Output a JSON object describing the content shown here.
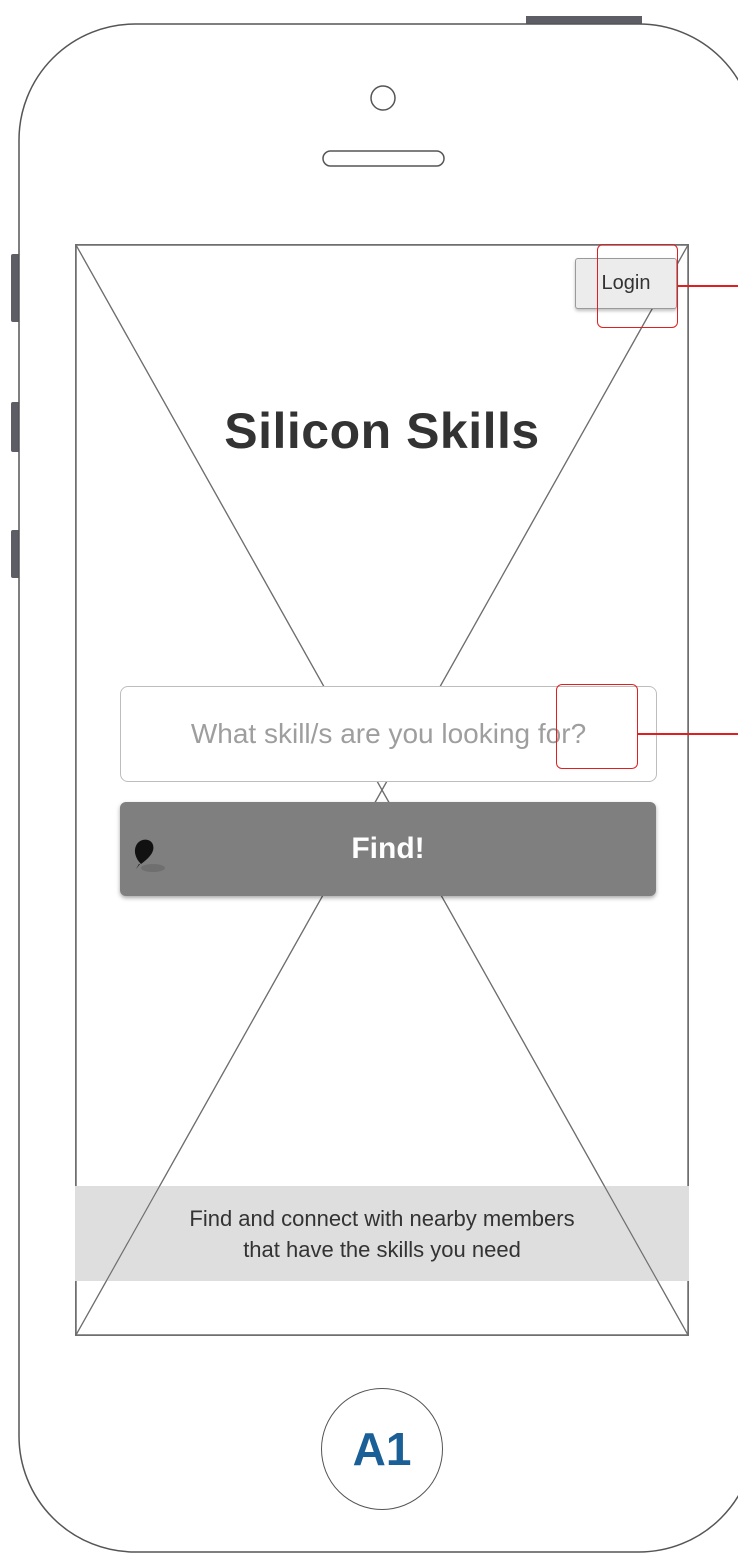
{
  "screen": {
    "login_label": "Login",
    "app_title": "Silicon Skills",
    "search_placeholder": "What skill/s are you looking for?",
    "find_label": "Find!",
    "tagline_line1": "Find and connect with nearby members",
    "tagline_line2": "that have the skills you need"
  },
  "device": {
    "home_label": "A1"
  },
  "colors": {
    "annotation": "#e02020",
    "find_button": "#7f7f7f",
    "home_label": "#1a5f96",
    "footer_band": "#dedede"
  },
  "icons": [
    "camera-icon",
    "speaker-icon",
    "location-pin-icon",
    "placeholder-cross-icon"
  ]
}
